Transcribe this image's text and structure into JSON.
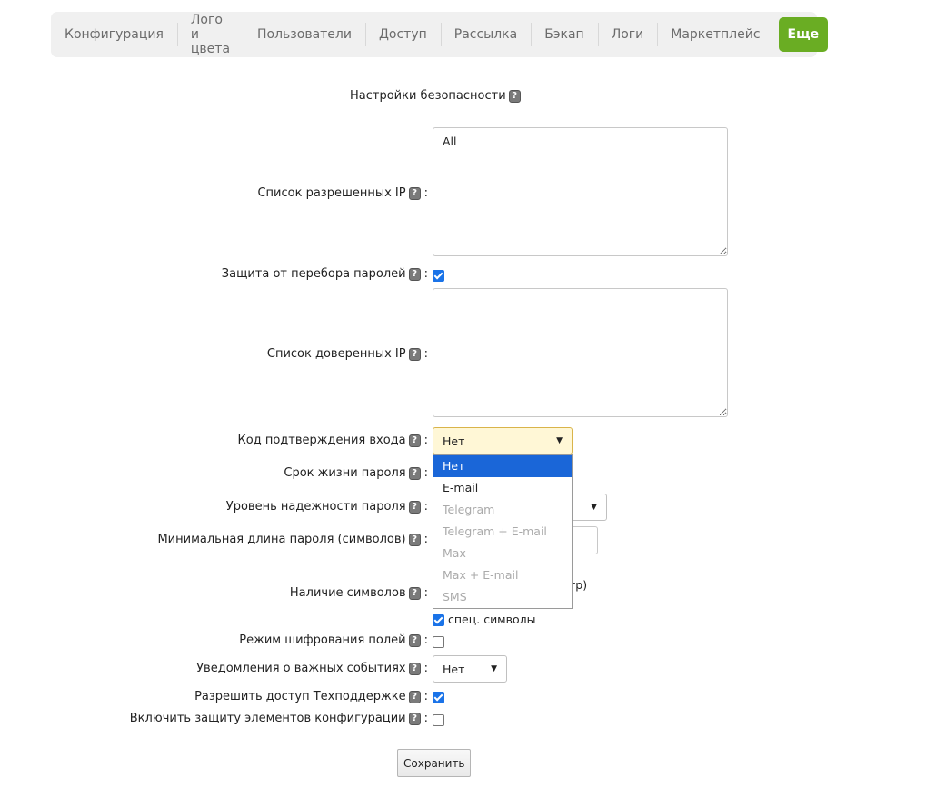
{
  "tabs": [
    {
      "label": "Конфигурация"
    },
    {
      "label": "Лого и цвета"
    },
    {
      "label": "Пользователи"
    },
    {
      "label": "Доступ"
    },
    {
      "label": "Рассылка"
    },
    {
      "label": "Бэкап"
    },
    {
      "label": "Логи"
    },
    {
      "label": "Маркетплейс"
    },
    {
      "label": "Еще",
      "active": true
    }
  ],
  "section_title": "Настройки безопасности",
  "help_glyph": "?",
  "colon": ":",
  "fields": {
    "allowed_ip": {
      "label": "Список разрешенных IP",
      "value": "All"
    },
    "brute_force": {
      "label": "Защита от перебора паролей",
      "checked": true
    },
    "trusted_ip": {
      "label": "Список доверенных IP",
      "value": ""
    },
    "login_code": {
      "label": "Код подтверждения входа",
      "value": "Нет"
    },
    "password_lifetime": {
      "label": "Срок жизни пароля"
    },
    "password_strength": {
      "label": "Уровень надежности пароля"
    },
    "min_length": {
      "label": "Минимальная длина пароля (символов)"
    },
    "symbols": {
      "label": "Наличие символов",
      "partial_text": "тр)",
      "special_label": "спец. символы",
      "special_checked": true
    },
    "field_encryption": {
      "label": "Режим шифрования полей",
      "checked": false
    },
    "notifications": {
      "label": "Уведомления о важных событиях",
      "value": "Нет"
    },
    "support_access": {
      "label": "Разрешить доступ Техподдержке",
      "checked": true
    },
    "config_protection": {
      "label": "Включить защиту элементов конфигурации",
      "checked": false
    }
  },
  "dropdown_options": [
    {
      "label": "Нет",
      "state": "selected"
    },
    {
      "label": "E-mail",
      "state": "enabled"
    },
    {
      "label": "Telegram",
      "state": "disabled"
    },
    {
      "label": "Telegram + E-mail",
      "state": "disabled"
    },
    {
      "label": "Max",
      "state": "disabled"
    },
    {
      "label": "Max + E-mail",
      "state": "disabled"
    },
    {
      "label": "SMS",
      "state": "disabled"
    }
  ],
  "dropdown_arrow": "▼",
  "save_label": "Сохранить",
  "colors": {
    "accent": "#6aad23",
    "selection": "#1a66d8",
    "checkbox": "#1a73e8",
    "focus_bg": "#fff7d6"
  }
}
